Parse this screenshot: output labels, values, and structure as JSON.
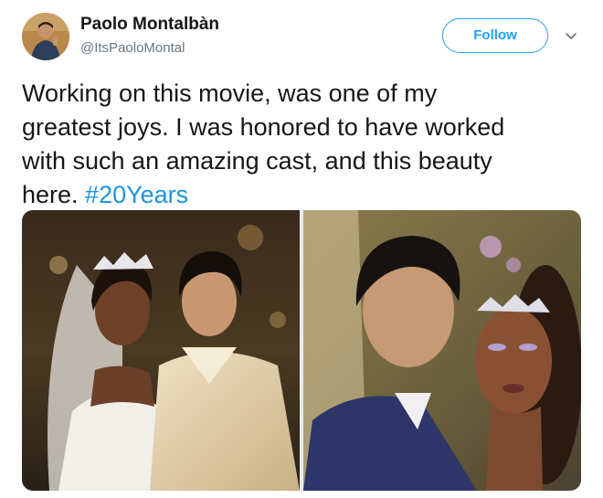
{
  "user": {
    "display_name": "Paolo Montalbàn",
    "handle": "@ItsPaoloMontal"
  },
  "follow_label": "Follow",
  "tweet": {
    "line1": "Working on this movie, was one of my",
    "line2": "greatest joys. I was honored to have worked",
    "line3": "with such an amazing cast, and this beauty",
    "line4_text": "here. ",
    "hashtag": "#20Years"
  },
  "icons": {
    "caret": "chevron-down-icon"
  },
  "colors": {
    "accent": "#1da1f2",
    "hashtag": "#1b95e0",
    "secondary_text": "#657786"
  }
}
